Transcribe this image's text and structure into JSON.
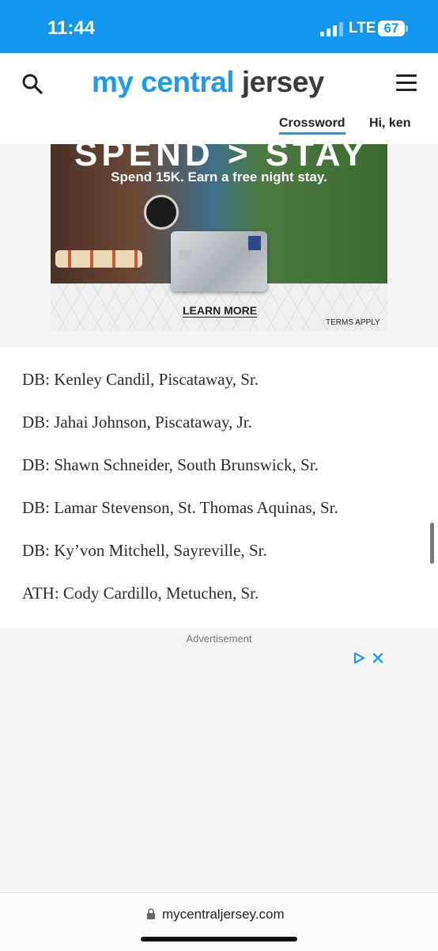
{
  "status_bar": {
    "time": "11:44",
    "network": "LTE",
    "battery": "67"
  },
  "header": {
    "logo_part1": "my central",
    "logo_part2": "jersey",
    "crossword": "Crossword",
    "greeting": "Hi, ken"
  },
  "top_ad": {
    "headline": "SPEND > STAY",
    "subline": "Spend 15K. Earn a free night stay.",
    "cta": "LEARN MORE",
    "terms": "TERMS APPLY"
  },
  "article": {
    "lines": [
      "DB: Kenley Candil, Piscataway, Sr.",
      "DB: Jahai Johnson, Piscataway, Jr.",
      "DB: Shawn Schneider, South Brunswick, Sr.",
      "DB: Lamar Stevenson, St. Thomas Aquinas, Sr.",
      "DB: Ky’von Mitchell, Sayreville, Sr.",
      "ATH: Cody Cardillo, Metuchen, Sr."
    ]
  },
  "ad_block": {
    "label": "Advertisement"
  },
  "url_bar": {
    "url": "mycentraljersey.com"
  },
  "colors": {
    "status_blue": "#1296ee",
    "brand_blue": "#1a9af0",
    "ad_blue": "#1a9af0"
  }
}
